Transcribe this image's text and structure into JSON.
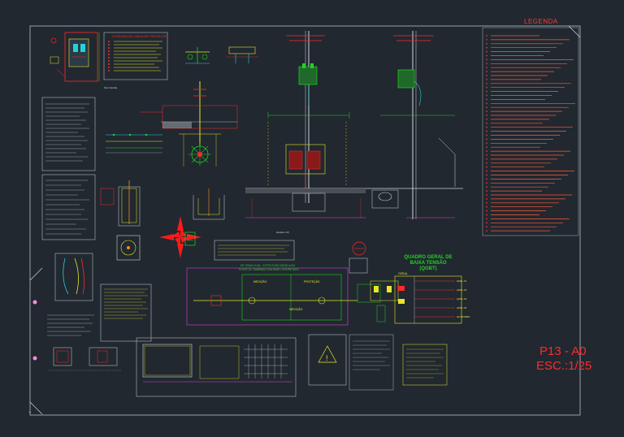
{
  "sheet": {
    "code": "P13 - A0",
    "scale": "ESC.:1/25"
  },
  "legend": {
    "title": "LEGENDA"
  },
  "panel": {
    "title_line1": "QUADRO GERAL DE",
    "title_line2": "BAIXA TENSÃO",
    "title_line3": "(QGBT)",
    "main_label": "GERAL",
    "circuits": [
      "QDFL-01",
      "QDFL-02",
      "QDFL-03",
      "QDFL-04",
      "QD-BOMBA"
    ]
  },
  "single_line": {
    "heading_line1": "DE TRAVA CUAV - ESTRUTURA SINGELA EM",
    "heading_line2": "POSTE DC TAMBRAM COM BASE CONCRETADA",
    "medicao": "MEDIÇÃO",
    "protecao": "PROTEÇÃO",
    "medicao2": "MEDIÇÃO"
  },
  "boxes": {
    "caixa_protecao_title": "LEGENDA DA CAIXA DE PROTEÇÃO",
    "vista_lateral": "VISTA LATERAL",
    "vista_frontal": "VISTA FRONTAL",
    "sem_escala": "Sem Escala",
    "escala": "Escala 1:25"
  },
  "colors": {
    "background": "#212830",
    "border": "#d9dde2",
    "red": "#ff2a2a",
    "green": "#21d321",
    "yellow": "#e6e62a",
    "cyan": "#27d0d8",
    "magenta": "#e040e0",
    "orange": "#ff8a1a"
  }
}
